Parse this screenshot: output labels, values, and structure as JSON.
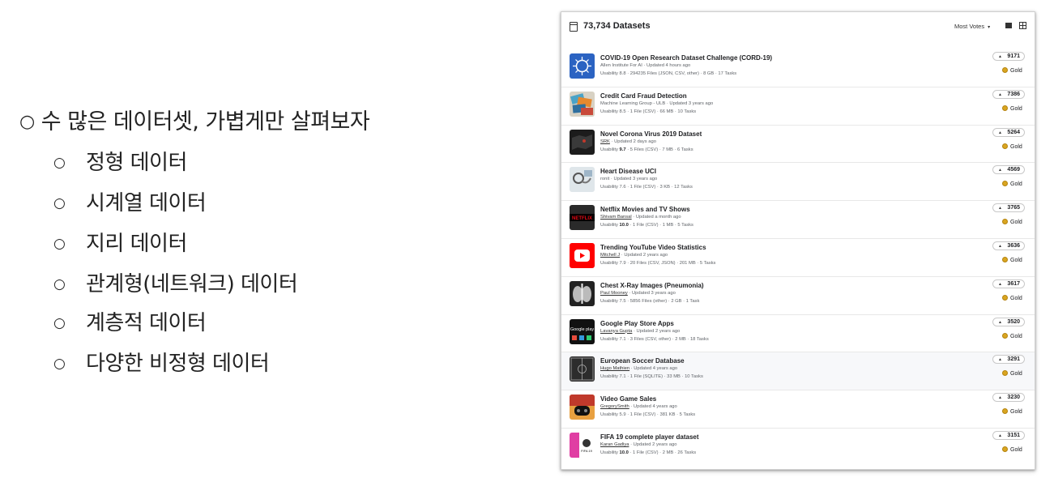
{
  "slide": {
    "main_bullet": "수 많은 데이터셋, 가볍게만 살펴보자",
    "main_marker": "○",
    "sub_marker": "○",
    "sub_bullets": [
      "정형 데이터",
      "시계열 데이터",
      "지리 데이터",
      "관계형(네트워크) 데이터",
      "계층적 데이터",
      "다양한 비정형 데이터"
    ]
  },
  "panel": {
    "title": "73,734 Datasets",
    "sort_label": "Most Votes",
    "sort_caret": "▾",
    "view_icons": [
      "list-view-icon",
      "grid-view-icon"
    ]
  },
  "datasets": [
    {
      "name": "COVID-19 Open Research Dataset Challenge (CORD-19)",
      "owner": "Allen Institute For AI",
      "owner_underlined": false,
      "updated": "Updated 4 hours ago",
      "usability": "8.8",
      "details": "294235 Files (JSON, CSV, other) · 8 GB · 17 Tasks",
      "votes": "9171",
      "medal": "Gold",
      "thumb": "covid"
    },
    {
      "name": "Credit Card Fraud Detection",
      "owner": "Machine Learning Group - ULB",
      "owner_underlined": false,
      "updated": "Updated 3 years ago",
      "usability": "8.5",
      "details": "1 File (CSV) · 66 MB · 10 Tasks",
      "votes": "7386",
      "medal": "Gold",
      "thumb": "cards"
    },
    {
      "name": "Novel Corona Virus 2019 Dataset",
      "owner": "SRK",
      "owner_underlined": true,
      "updated": "Updated 2 days ago",
      "usability": "9.7",
      "usability_bold": true,
      "details": "5 Files (CSV) · 7 MB · 6 Tasks",
      "votes": "5264",
      "medal": "Gold",
      "thumb": "map"
    },
    {
      "name": "Heart Disease UCI",
      "owner": "ronit",
      "owner_underlined": false,
      "updated": "Updated 3 years ago",
      "usability": "7.6",
      "details": "1 File (CSV) · 3 KB · 12 Tasks",
      "votes": "4569",
      "medal": "Gold",
      "thumb": "heart"
    },
    {
      "name": "Netflix Movies and TV Shows",
      "owner": "Shivam Bansal",
      "owner_underlined": true,
      "updated": "Updated a month ago",
      "usability": "10.0",
      "usability_bold": true,
      "details": "1 File (CSV) · 1 MB · 5 Tasks",
      "votes": "3765",
      "medal": "Gold",
      "thumb": "netflix",
      "thumb_text": "NETFLIX"
    },
    {
      "name": "Trending YouTube Video Statistics",
      "owner": "Mitchell J",
      "owner_underlined": true,
      "updated": "Updated 2 years ago",
      "usability": "7.9",
      "details": "20 Files (CSV, JSON) · 201 MB · 5 Tasks",
      "votes": "3636",
      "medal": "Gold",
      "thumb": "youtube"
    },
    {
      "name": "Chest X-Ray Images (Pneumonia)",
      "owner": "Paul Mooney",
      "owner_underlined": true,
      "updated": "Updated 3 years ago",
      "usability": "7.5",
      "details": "5856 Files (other) · 2 GB · 1 Task",
      "votes": "3617",
      "medal": "Gold",
      "thumb": "xray"
    },
    {
      "name": "Google Play Store Apps",
      "owner": "Lavanya Gupta",
      "owner_underlined": true,
      "updated": "Updated 2 years ago",
      "usability": "7.1",
      "details": "3 Files (CSV, other) · 2 MB · 18 Tasks",
      "votes": "3520",
      "medal": "Gold",
      "thumb": "gplay",
      "thumb_text": "Google play"
    },
    {
      "name": "European Soccer Database",
      "owner": "Hugo Mathien",
      "owner_underlined": true,
      "updated": "Updated 4 years ago",
      "usability": "7.1",
      "details": "1 File (SQLITE) · 33 MB · 10 Tasks",
      "votes": "3291",
      "medal": "Gold",
      "thumb": "soccer",
      "highlight": true
    },
    {
      "name": "Video Game Sales",
      "owner": "GregorySmith",
      "owner_underlined": true,
      "updated": "Updated 4 years ago",
      "usability": "5.9",
      "details": "1 File (CSV) · 381 KB · 5 Tasks",
      "votes": "3230",
      "medal": "Gold",
      "thumb": "game"
    },
    {
      "name": "FIFA 19 complete player dataset",
      "owner": "Karan Gadiya",
      "owner_underlined": true,
      "updated": "Updated 2 years ago",
      "usability": "10.0",
      "usability_bold": true,
      "details": "1 File (CSV) · 2 MB · 26 Tasks",
      "votes": "3151",
      "medal": "Gold",
      "thumb": "fifa",
      "thumb_text": "FIFA 19"
    }
  ],
  "labels": {
    "usability_prefix": "Usability",
    "sep": " · ",
    "upvote": "▲"
  },
  "colors": {
    "gold_medal": "#d9a520",
    "youtube_red": "#ff0000",
    "netflix_red": "#e50914",
    "covid_blue": "#2b63c2"
  }
}
